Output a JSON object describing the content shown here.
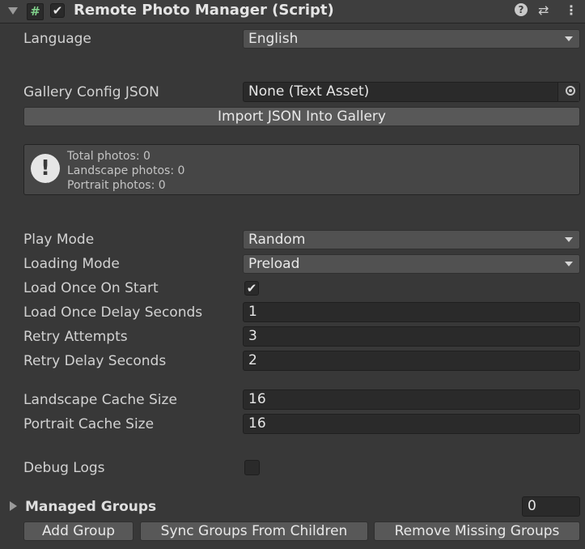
{
  "header": {
    "script_icon": "#",
    "enabled": true,
    "title": "Remote Photo Manager (Script)",
    "icons": [
      "help-icon",
      "presets-icon",
      "menu-icon"
    ]
  },
  "fields": {
    "language": {
      "label": "Language",
      "value": "English"
    },
    "gallery_config": {
      "label": "Gallery Config JSON",
      "value": "None (Text Asset)"
    },
    "import_button": "Import JSON Into Gallery",
    "info": {
      "total": "Total photos: 0",
      "landscape": "Landscape photos: 0",
      "portrait": "Portrait photos: 0"
    },
    "play_mode": {
      "label": "Play Mode",
      "value": "Random"
    },
    "loading_mode": {
      "label": "Loading Mode",
      "value": "Preload"
    },
    "load_once_on_start": {
      "label": "Load Once On Start",
      "checked": true
    },
    "load_once_delay": {
      "label": "Load Once Delay Seconds",
      "value": "1"
    },
    "retry_attempts": {
      "label": "Retry Attempts",
      "value": "3"
    },
    "retry_delay": {
      "label": "Retry Delay Seconds",
      "value": "2"
    },
    "landscape_cache": {
      "label": "Landscape Cache Size",
      "value": "16"
    },
    "portrait_cache": {
      "label": "Portrait Cache Size",
      "value": "16"
    },
    "debug_logs": {
      "label": "Debug Logs",
      "checked": false
    }
  },
  "managed_groups": {
    "label": "Managed Groups",
    "count": "0",
    "buttons": {
      "add": "Add Group",
      "sync": "Sync Groups From Children",
      "remove_missing": "Remove Missing Groups"
    }
  },
  "glyphs": {
    "check": "✔",
    "help": "?",
    "presets": "⇄",
    "menu": "⋮",
    "warning": "!"
  }
}
